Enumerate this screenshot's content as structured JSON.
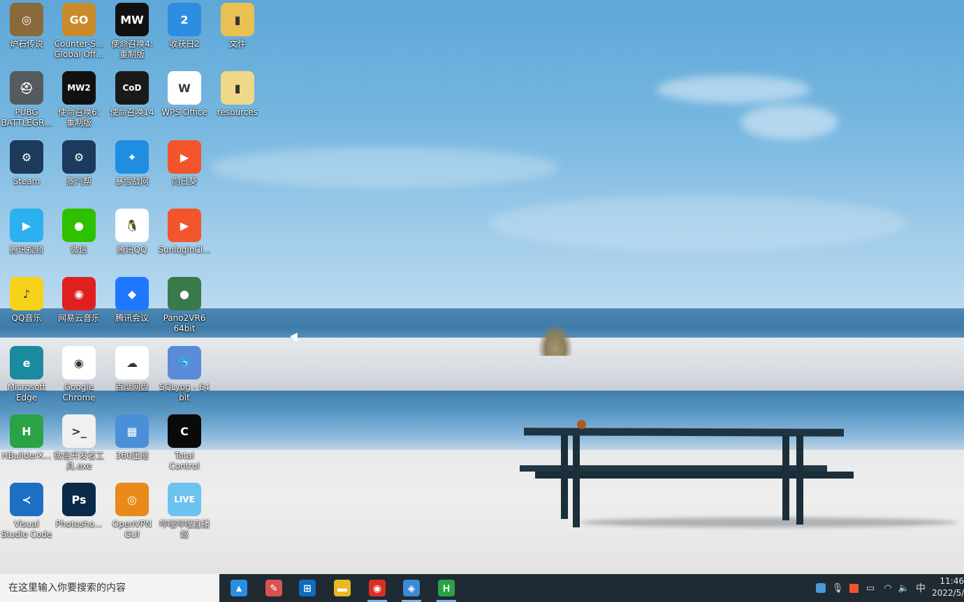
{
  "desktop": {
    "icons": [
      {
        "label": "炉石传说",
        "icon": "hearthstone-icon",
        "bg": "#8a6a3a",
        "glyph": "◎"
      },
      {
        "label": "Counter-S...\nGlobal Off...",
        "icon": "csgo-icon",
        "bg": "#c98a2a",
        "glyph": "GO"
      },
      {
        "label": "使命召唤4:\n重制版",
        "icon": "mw-icon",
        "bg": "#111111",
        "glyph": "MW"
      },
      {
        "label": "收获日2",
        "icon": "payday2-icon",
        "bg": "#2d8de0",
        "glyph": "2"
      },
      {
        "label": "文件",
        "icon": "folder-icon",
        "bg": "#e8c152",
        "glyph": "▮"
      },
      {
        "label": "PUBG\nBATTLEGR...",
        "icon": "pubg-icon",
        "bg": "#555a5e",
        "glyph": "⛑"
      },
      {
        "label": "使命召唤6:\n重制版",
        "icon": "mw2-icon",
        "bg": "#111111",
        "glyph": "MW2"
      },
      {
        "label": "使命召唤14",
        "icon": "cod-wwii-icon",
        "bg": "#1a1a1a",
        "glyph": "CoD"
      },
      {
        "label": "WPS Office",
        "icon": "wps-icon",
        "bg": "#ffffff",
        "glyph": "W"
      },
      {
        "label": "resources",
        "icon": "folder-icon",
        "bg": "#f0d88a",
        "glyph": "▮"
      },
      {
        "label": "Steam",
        "icon": "steam-icon",
        "bg": "#1b3a5c",
        "glyph": "⚙"
      },
      {
        "label": "蒸汽帮",
        "icon": "steam-helper-icon",
        "bg": "#1b3a5c",
        "glyph": "⚙"
      },
      {
        "label": "暴雪战网",
        "icon": "battlenet-icon",
        "bg": "#1f8ee0",
        "glyph": "✦"
      },
      {
        "label": "向日葵",
        "icon": "sunlogin-icon",
        "bg": "#f2552c",
        "glyph": "▶"
      },
      {
        "label": "腾讯视频",
        "icon": "tencent-video-icon",
        "bg": "#2bb0f0",
        "glyph": "▶"
      },
      {
        "label": "微信",
        "icon": "wechat-icon",
        "bg": "#2dc100",
        "glyph": "●"
      },
      {
        "label": "腾讯QQ",
        "icon": "qq-icon",
        "bg": "#ffffff",
        "glyph": "🐧"
      },
      {
        "label": "SunloginCl...",
        "icon": "sunlogin-icon",
        "bg": "#f2552c",
        "glyph": "▶"
      },
      {
        "label": "QQ音乐",
        "icon": "qq-music-icon",
        "bg": "#f7d21a",
        "glyph": "♪"
      },
      {
        "label": "网易云音乐",
        "icon": "netease-music-icon",
        "bg": "#e02020",
        "glyph": "◉"
      },
      {
        "label": "腾讯会议",
        "icon": "tencent-meeting-icon",
        "bg": "#1e78ff",
        "glyph": "◆"
      },
      {
        "label": "Pano2VR6\n64bit",
        "icon": "pano2vr-icon",
        "bg": "#3a7a4a",
        "glyph": "●"
      },
      {
        "label": "Microsoft\nEdge",
        "icon": "edge-icon",
        "bg": "#1b8a9e",
        "glyph": "e"
      },
      {
        "label": "Google\nChrome",
        "icon": "chrome-icon",
        "bg": "#ffffff",
        "glyph": "◉"
      },
      {
        "label": "百度网盘",
        "icon": "baidu-netdisk-icon",
        "bg": "#ffffff",
        "glyph": "☁"
      },
      {
        "label": "SQLyog - 64\nbit",
        "icon": "sqlyog-icon",
        "bg": "#5a8ad8",
        "glyph": "🐬"
      },
      {
        "label": "HBuilderX...",
        "icon": "hbuilderx-icon",
        "bg": "#2ba245",
        "glyph": "H"
      },
      {
        "label": "微信开发者工\n具.exe",
        "icon": "wechat-devtools-icon",
        "bg": "#f0f0f0",
        "glyph": ">_"
      },
      {
        "label": "360压缩",
        "icon": "360zip-icon",
        "bg": "#4a90d9",
        "glyph": "▦"
      },
      {
        "label": "Total\nControl",
        "icon": "total-control-icon",
        "bg": "#0a0a0a",
        "glyph": "C"
      },
      {
        "label": "Visual\nStudio Code",
        "icon": "vscode-icon",
        "bg": "#1d6fc4",
        "glyph": "≺"
      },
      {
        "label": "Photosho...",
        "icon": "photoshop-icon",
        "bg": "#0b2a4a",
        "glyph": "Ps"
      },
      {
        "label": "OpenVPN\nGUI",
        "icon": "openvpn-icon",
        "bg": "#e88a1a",
        "glyph": "◎"
      },
      {
        "label": "哔哩哔哩直播\n姬",
        "icon": "bilibili-live-icon",
        "bg": "#6cc3f0",
        "glyph": "LIVE"
      }
    ]
  },
  "taskbar": {
    "search_placeholder": "在这里输入你要搜索的内容",
    "apps": [
      {
        "name": "app-launcher-icon",
        "bg": "#2a8fe0",
        "glyph": "▲"
      },
      {
        "name": "paint-icon",
        "bg": "#d9534f",
        "glyph": "✎"
      },
      {
        "name": "store-icon",
        "bg": "#0f6cbd",
        "glyph": "⊞"
      },
      {
        "name": "file-explorer-icon",
        "bg": "#e8b923",
        "glyph": "▬"
      },
      {
        "name": "chrome-icon",
        "bg": "#d93025",
        "glyph": "◉"
      },
      {
        "name": "screenshot-tool-icon",
        "bg": "#3a8ad6",
        "glyph": "◈"
      },
      {
        "name": "hbuilderx-icon",
        "bg": "#2ba245",
        "glyph": "H"
      }
    ],
    "tray": {
      "ime": "中",
      "time": "11:46",
      "date": "2022/5/"
    }
  }
}
